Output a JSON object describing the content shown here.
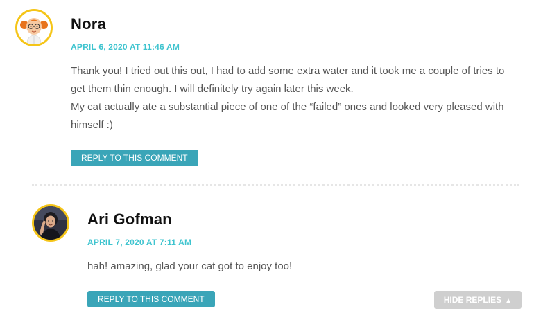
{
  "comments": [
    {
      "author": "Nora",
      "date": "APRIL 6, 2020 AT 11:46 AM",
      "paragraphs": [
        "Thank you! I tried out this out, I had to add some extra water and it took me a couple of tries to get them thin enough. I will definitely try again later this week.",
        "My cat actually ate a substantial piece of one of the “failed” ones and looked very pleased with himself :)"
      ],
      "reply_label": "REPLY TO THIS COMMENT",
      "avatar_icon": "cartoon-girl-avatar"
    },
    {
      "author": "Ari Gofman",
      "date": "APRIL 7, 2020 AT 7:11 AM",
      "paragraphs": [
        "hah! amazing, glad your cat got to enjoy too!"
      ],
      "reply_label": "REPLY TO THIS COMMENT",
      "avatar_icon": "photo-avatar"
    }
  ],
  "hide_replies_label": "HIDE REPLIES",
  "hide_replies_icon": "triangle-up-icon",
  "colors": {
    "accent": "#3fc4cf",
    "button": "#3aa5b8",
    "avatar_ring": "#f5c518",
    "hide_button": "#cfcfcf"
  }
}
